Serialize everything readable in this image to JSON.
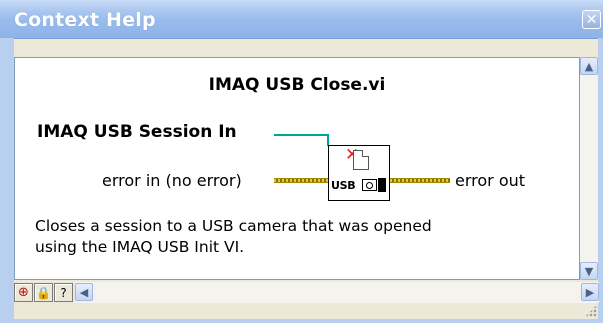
{
  "window": {
    "title": "Context Help",
    "close_glyph": "✕"
  },
  "help": {
    "vi_name": "IMAQ USB Close.vi",
    "terminals": {
      "session_in": "IMAQ USB Session In",
      "error_in": "error in (no error)",
      "error_out": "error out"
    },
    "icon": {
      "text": "USB",
      "icon_name": "usb-close-vi-icon"
    },
    "description_line1": "Closes a session to a USB camera that was opened",
    "description_line2": "using the IMAQ USB Init VI."
  },
  "toolbar": {
    "buttons": [
      {
        "name": "show-block-diagram-button",
        "glyph": "⊕"
      },
      {
        "name": "lock-button",
        "glyph": "🔒"
      },
      {
        "name": "detailed-help-button",
        "glyph": "?"
      }
    ]
  },
  "scroll": {
    "up": "▲",
    "down": "▼",
    "left": "◀",
    "right": "▶"
  },
  "colors": {
    "session_wire": "#00a59a",
    "error_wire": "#e2c64a",
    "title_bar": "#98bbeb"
  }
}
